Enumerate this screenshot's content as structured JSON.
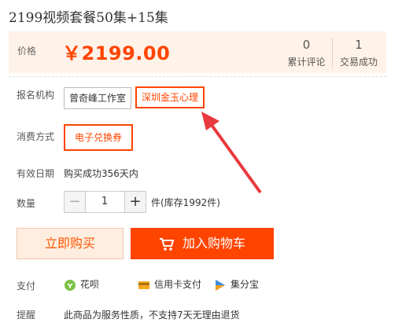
{
  "product": {
    "title": "2199视频套餐50集+15集"
  },
  "price": {
    "label": "价格",
    "value": "￥2199.00"
  },
  "stats": [
    {
      "num": "0",
      "label": "累计评论"
    },
    {
      "num": "1",
      "label": "交易成功"
    }
  ],
  "institution": {
    "label": "报名机构",
    "options": [
      "曾奇峰工作室",
      "深圳金玉心理"
    ],
    "selected": "深圳金玉心理"
  },
  "consumption": {
    "label": "消费方式",
    "options": [
      "电子兑换券"
    ],
    "selected": "电子兑换券"
  },
  "validity": {
    "label": "有效日期",
    "value": "购买成功356天内"
  },
  "quantity": {
    "label": "数量",
    "minus": "−",
    "value": "1",
    "plus": "+",
    "stock": "件(库存1992件)"
  },
  "actions": {
    "buy_now": "立即购买",
    "add_cart": "加入购物车"
  },
  "payment": {
    "label": "支付",
    "methods": [
      {
        "name": "花呗",
        "icon": "huabei-icon",
        "color": "#7ac143"
      },
      {
        "name": "信用卡支付",
        "icon": "credit-card-icon",
        "color": "#f5a623"
      },
      {
        "name": "集分宝",
        "icon": "jifenbao-icon",
        "color": "#3a8ee6"
      }
    ]
  },
  "reminder": {
    "label": "提醒",
    "text": "此商品为服务性质，不支持7天无理由退货"
  },
  "colors": {
    "accent": "#ff4400",
    "price_bg": "#fff2e8",
    "annotation_arrow": "#e8393d"
  }
}
